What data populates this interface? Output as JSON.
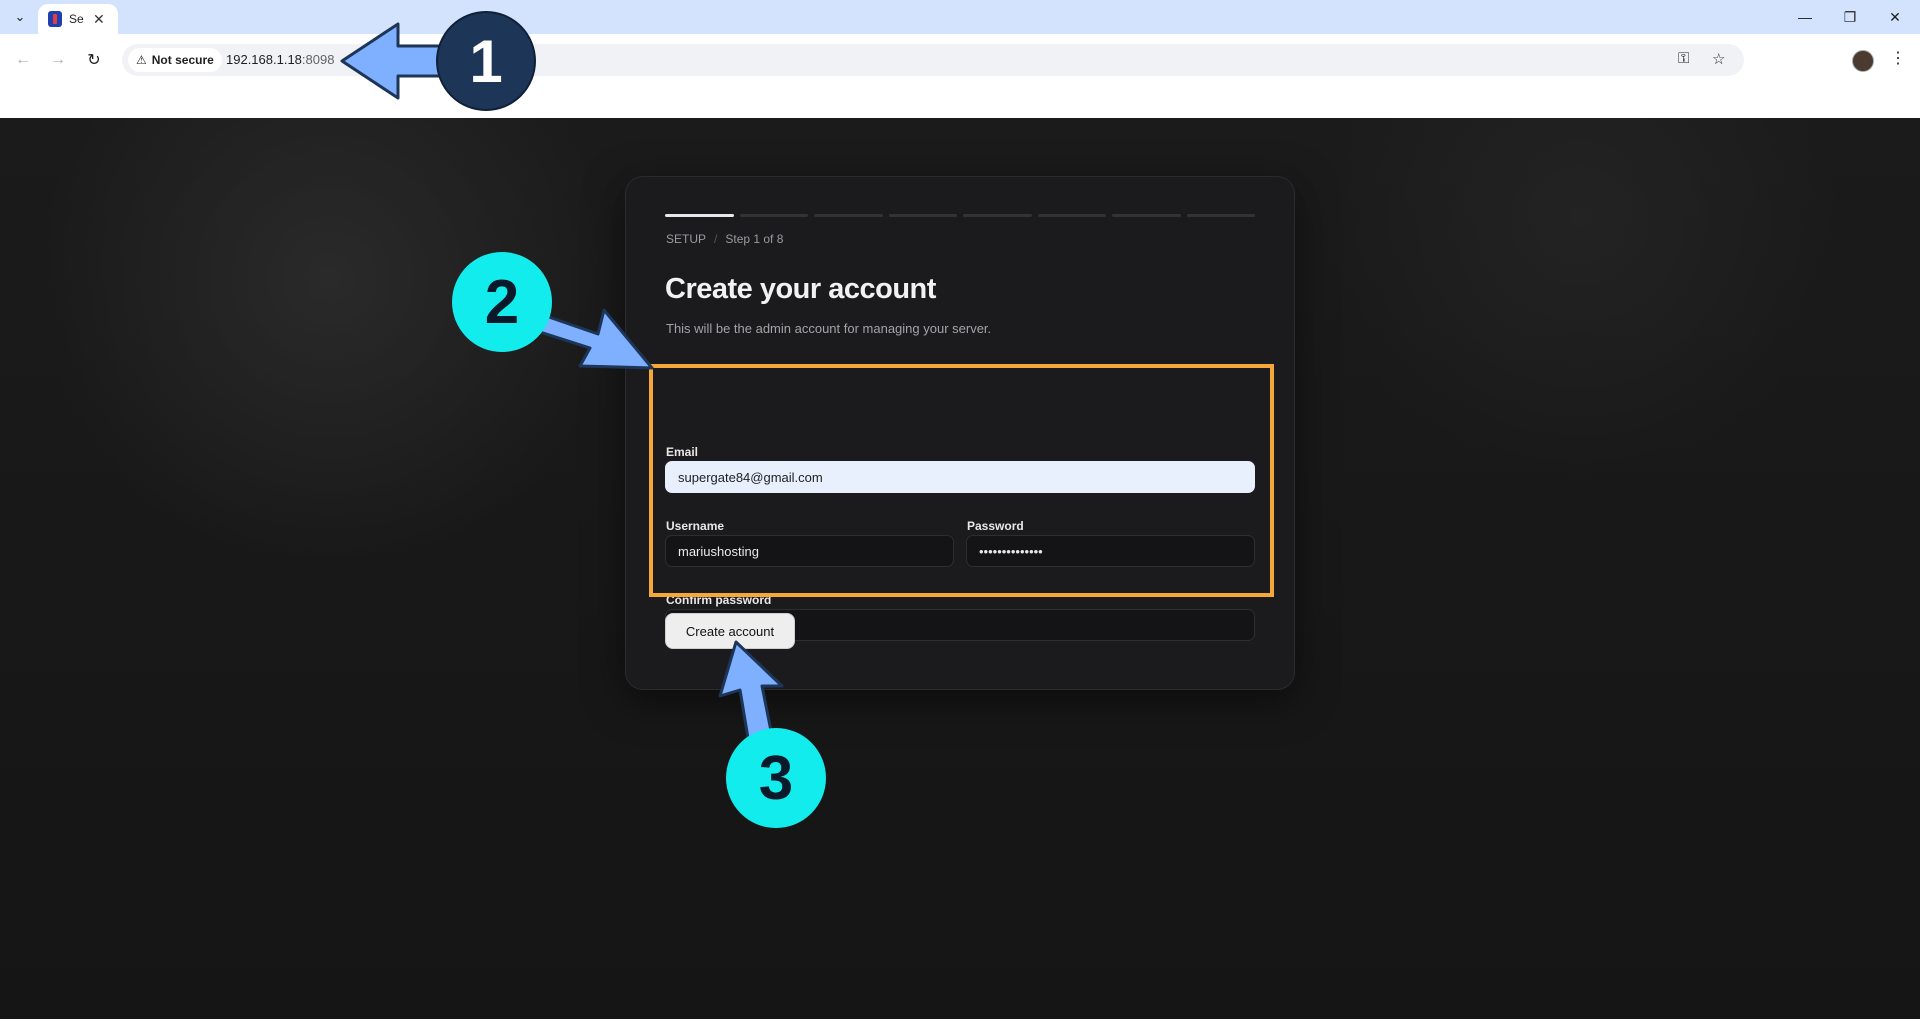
{
  "browser": {
    "tab_title": "Se",
    "address_chip": "Not secure",
    "url_host": "192.168.1.18",
    "url_port": ":8098",
    "window_controls": [
      "minimize-icon",
      "restore-icon",
      "close-icon"
    ]
  },
  "setup": {
    "breadcrumb_root": "SETUP",
    "breadcrumb_sep": "/",
    "breadcrumb_step": "Step 1 of 8",
    "total_steps": 8,
    "current_step": 1,
    "title": "Create your account",
    "subtitle": "This will be the admin account for managing your server."
  },
  "form": {
    "email_label": "Email",
    "email_value": "supergate84@gmail.com",
    "username_label": "Username",
    "username_value": "mariushosting",
    "password_label": "Password",
    "password_value": "••••••••••••••",
    "confirm_label": "Confirm password",
    "confirm_value": "••••••••••••••",
    "submit_label": "Create account"
  },
  "annotations": {
    "badge_1": "1",
    "badge_2": "2",
    "badge_3": "3"
  },
  "colors": {
    "highlight": "#f4a83a",
    "arrow": "#7fb0ff",
    "badge_dark": "#1d3557",
    "badge_cyan": "#13ecec"
  }
}
